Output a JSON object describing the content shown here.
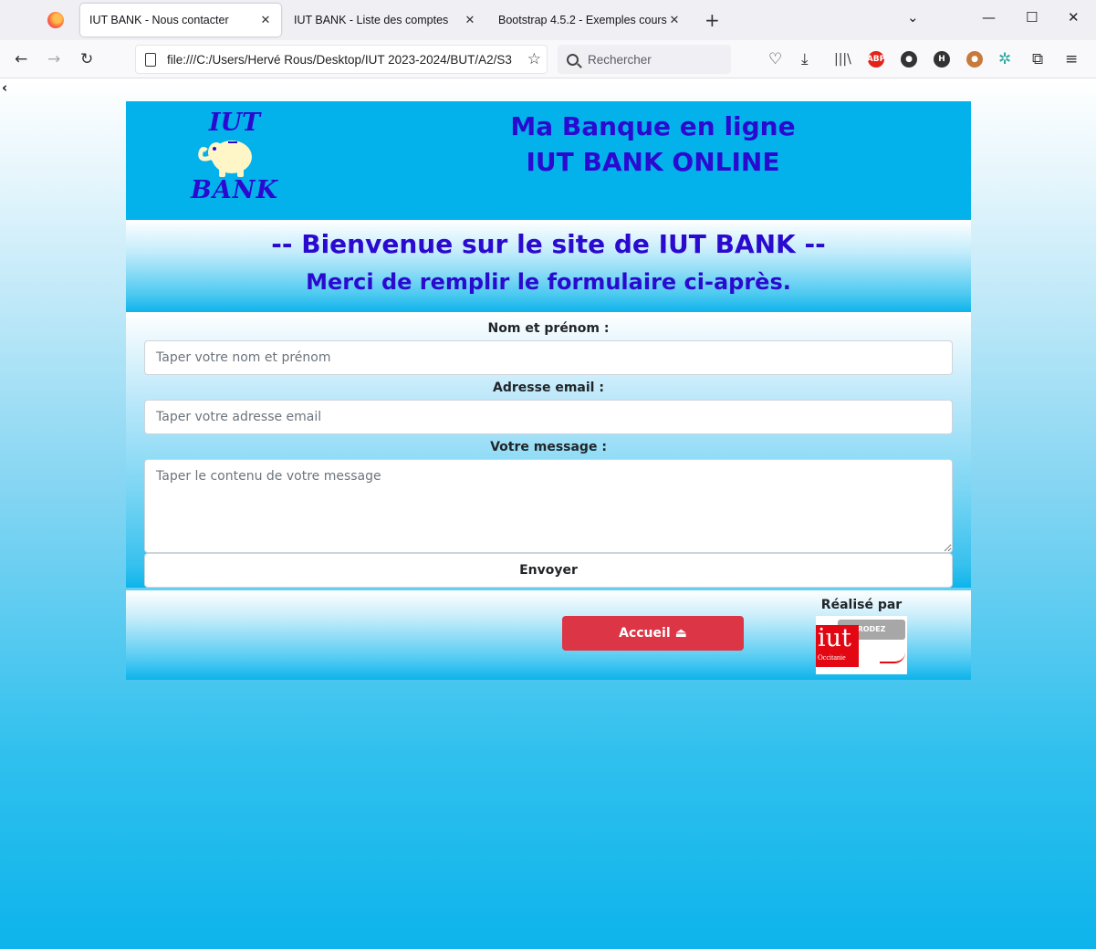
{
  "browser": {
    "tabs": [
      {
        "label": "IUT BANK - Nous contacter",
        "active": true
      },
      {
        "label": "IUT BANK - Liste des comptes",
        "active": false
      },
      {
        "label": "Bootstrap 4.5.2 - Exemples cours",
        "active": false
      }
    ],
    "url": "file:///C:/Users/Hervé Rous/Desktop/IUT 2023-2024/BUT/A2/S3",
    "search_placeholder": "Rechercher",
    "extensions": [
      "ABP",
      "H"
    ]
  },
  "header": {
    "logo_top": "IUT",
    "logo_bottom": "BANK",
    "title_line1": "Ma Banque en ligne",
    "title_line2": "IUT BANK ONLINE"
  },
  "welcome": {
    "line1": "-- Bienvenue sur le site de IUT BANK --",
    "line2": "Merci de remplir le formulaire ci-après."
  },
  "form": {
    "name_label": "Nom et prénom :",
    "name_placeholder": "Taper votre nom et prénom",
    "email_label": "Adresse email :",
    "email_placeholder": "Taper votre adresse email",
    "message_label": "Votre message :",
    "message_placeholder": "Taper le contenu de votre message",
    "submit_label": "Envoyer"
  },
  "footer": {
    "home_button": "Accueil",
    "made_by": "Réalisé par",
    "logo_word": "iut",
    "logo_region": "Occitanie",
    "logo_site": "RODEZ"
  },
  "colors": {
    "header_bg": "#03b1eb",
    "title_color": "#2b0ad0",
    "home_button": "#dc3545"
  }
}
